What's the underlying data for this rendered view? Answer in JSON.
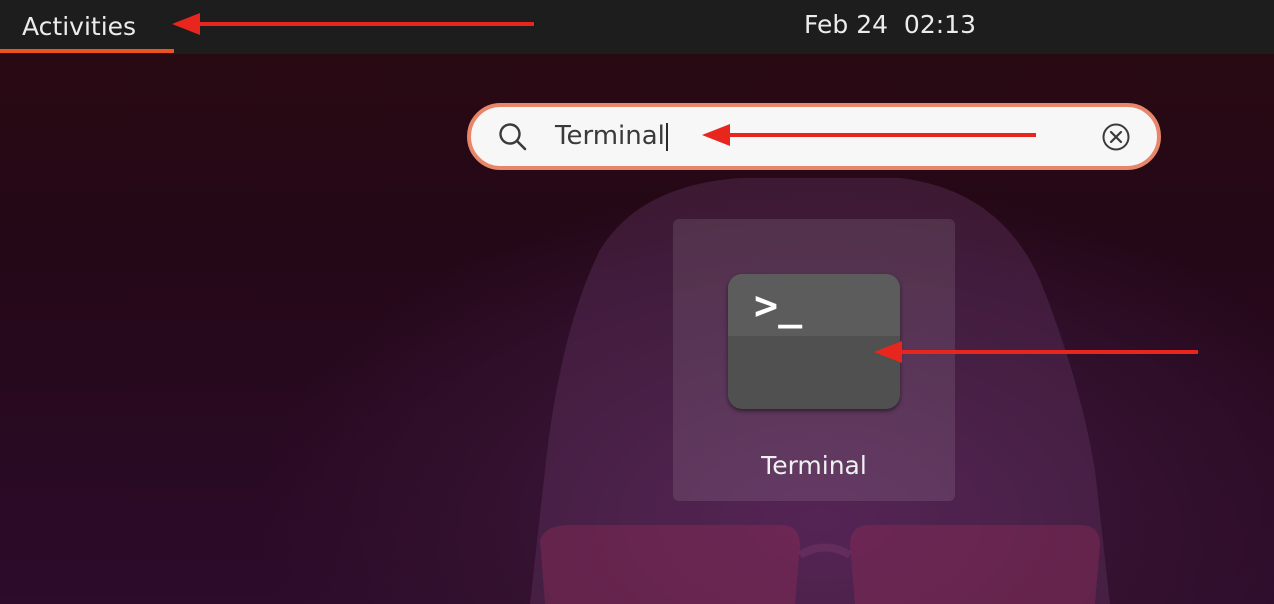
{
  "topbar": {
    "activities_label": "Activities",
    "clock": "Feb 24  02:13"
  },
  "search": {
    "query": "Terminal"
  },
  "results": [
    {
      "label": "Terminal",
      "icon": "terminal-icon",
      "icon_glyph": ">_"
    }
  ],
  "colors": {
    "accent": "#e95420",
    "annotation": "#e8261e",
    "topbar": "#1d1d1d"
  }
}
